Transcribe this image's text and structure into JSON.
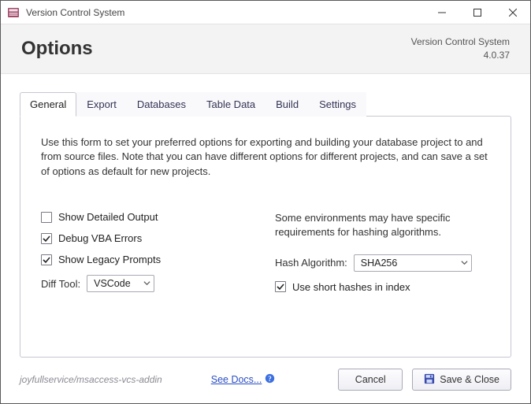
{
  "window": {
    "title": "Version Control System"
  },
  "header": {
    "title": "Options",
    "product": "Version Control System",
    "version": "4.0.37"
  },
  "tabs": [
    {
      "label": "General",
      "active": true
    },
    {
      "label": "Export",
      "active": false
    },
    {
      "label": "Databases",
      "active": false
    },
    {
      "label": "Table Data",
      "active": false
    },
    {
      "label": "Build",
      "active": false
    },
    {
      "label": "Settings",
      "active": false
    }
  ],
  "general": {
    "intro": "Use this form to set your preferred options for exporting and building your database project to and from source files. Note that you can have different options for different projects, and can save a set of options as default for new projects.",
    "show_detailed_output": {
      "label": "Show Detailed Output",
      "checked": false
    },
    "debug_vba_errors": {
      "label": "Debug VBA Errors",
      "checked": true
    },
    "show_legacy_prompts": {
      "label": "Show Legacy Prompts",
      "checked": true
    },
    "diff_tool": {
      "label": "Diff Tool:",
      "value": "VSCode"
    },
    "hash_note": "Some environments may have specific requirements for hashing algorithms.",
    "hash_algorithm": {
      "label": "Hash Algorithm:",
      "value": "SHA256"
    },
    "use_short_hashes": {
      "label": "Use short hashes in index",
      "checked": true
    }
  },
  "footer": {
    "repo": "joyfullservice/msaccess-vcs-addin",
    "docs_label": "See Docs...",
    "cancel_label": "Cancel",
    "save_label": "Save & Close"
  }
}
